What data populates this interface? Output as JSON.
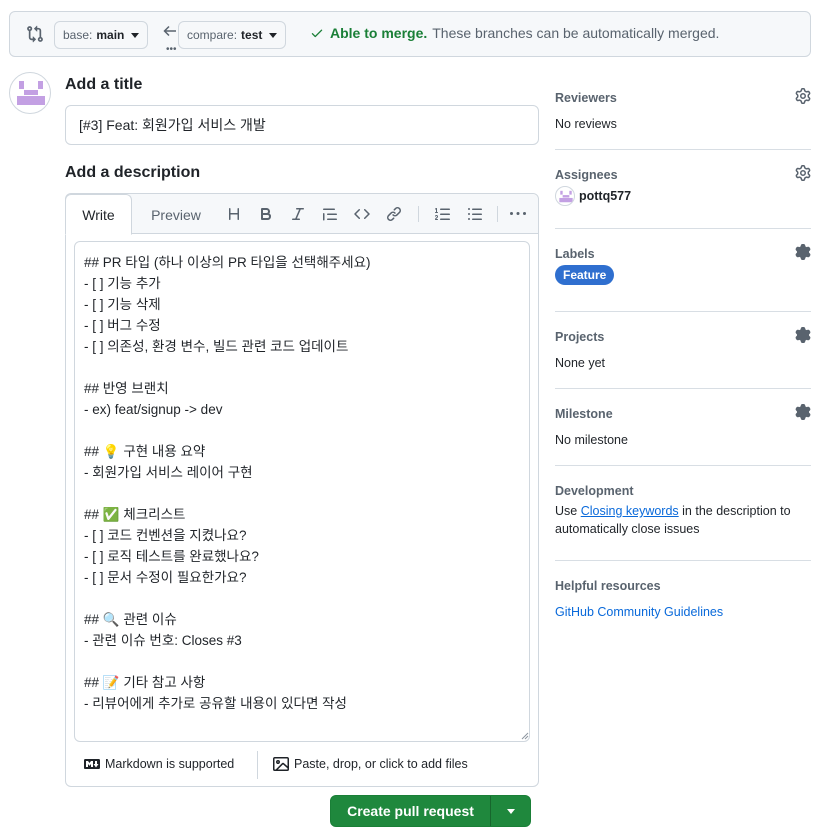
{
  "compare_bar": {
    "base_prefix": "base:",
    "base_branch": "main",
    "compare_prefix": "compare:",
    "compare_branch": "test",
    "merge_ok": "Able to merge.",
    "merge_detail": "These branches can be automatically merged."
  },
  "form": {
    "title_heading": "Add a title",
    "title_value": "[#3] Feat: 회원가입 서비스 개발",
    "description_heading": "Add a description",
    "tabs": [
      "Write",
      "Preview"
    ],
    "toolbar_icons": [
      "heading-icon",
      "bold-icon",
      "italic-icon",
      "quote-icon",
      "code-icon",
      "link-icon",
      "ordered-list-icon",
      "unordered-list-icon",
      "more-icon"
    ],
    "body_lines": [
      "## PR 타입 (하나 이상의 PR 타입을 선택해주세요)",
      "- [ ] 기능 추가",
      "- [ ] 기능 삭제",
      "- [ ] 버그 수정",
      "- [ ] 의존성, 환경 변수, 빌드 관련 코드 업데이트",
      "",
      "## 반영 브랜치",
      "- ex) feat/signup -> dev",
      "",
      "## 💡 구현 내용 요약",
      "- 회원가입 서비스 레이어 구현",
      "",
      "## ✅ 체크리스트",
      "- [ ] 코드 컨벤션을 지켰나요?",
      "- [ ] 로직 테스트를 완료했나요?",
      "- [ ] 문서 수정이 필요한가요?",
      "",
      "## 🔍 관련 이슈",
      "- 관련 이슈 번호: Closes #3",
      "",
      "## 📝 기타 참고 사항",
      "- 리뷰어에게 추가로 공유할 내용이 있다면 작성"
    ],
    "markdown_note": "Markdown is supported",
    "attach_note": "Paste, drop, or click to add files",
    "submit_label": "Create pull request"
  },
  "sidebar": {
    "reviewers": {
      "title": "Reviewers",
      "value": "No reviews"
    },
    "assignees": {
      "title": "Assignees",
      "user": "pottq577"
    },
    "labels": {
      "title": "Labels",
      "label": "Feature",
      "label_color": "#2f6fcf"
    },
    "projects": {
      "title": "Projects",
      "value": "None yet"
    },
    "milestone": {
      "title": "Milestone",
      "value": "No milestone"
    },
    "development": {
      "title": "Development",
      "text_before": "Use ",
      "link": "Closing keywords",
      "text_after": " in the description to automatically close issues"
    },
    "resources": {
      "title": "Helpful resources",
      "link": "GitHub Community Guidelines"
    }
  },
  "colors": {
    "accent_green": "#1f883d",
    "link_blue": "#0969da",
    "muted": "#59636e"
  }
}
